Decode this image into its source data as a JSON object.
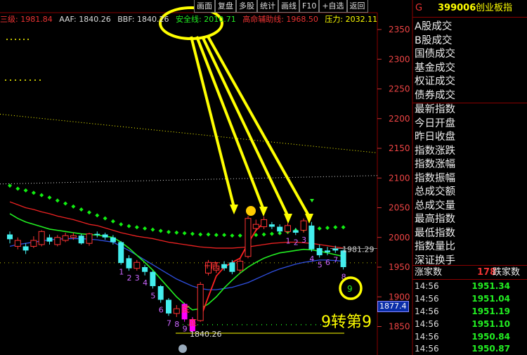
{
  "toolbar": {
    "items": [
      "画面",
      "复盘",
      "多股",
      "统计",
      "画线",
      "F10",
      "+自选",
      "返回"
    ]
  },
  "indicators": [
    {
      "label": "三级: 1981.84",
      "color": "#e33"
    },
    {
      "label": "AAF: 1840.26",
      "color": "#ddd"
    },
    {
      "label": "BBF: 1840.26",
      "color": "#ddd"
    },
    {
      "label": "安全线: 2010.71",
      "color": "#2e2"
    },
    {
      "label": "高命辅助线: 1968.50",
      "color": "#e33"
    },
    {
      "label": "压力: 2032.11",
      "color": "#ff0"
    }
  ],
  "header": {
    "market_code": "G",
    "code": "399006",
    "name": "创业板指"
  },
  "menu_group1": [
    "A股成交",
    "B股成交",
    "国债成交",
    "基金成交",
    "权证成交",
    "债券成交"
  ],
  "menu_group2": [
    "最新指数",
    "今日开盘",
    "昨日收盘",
    "指数涨跌",
    "指数涨幅",
    "指数振幅",
    "总成交额",
    "总成交量",
    "最高指数",
    "最低指数",
    "指数量比",
    "深证换手"
  ],
  "stats": {
    "up_label": "涨家数",
    "up_count": "178",
    "down_label": "跌家数"
  },
  "ticks": [
    {
      "time": "14:56",
      "value": "1951.34"
    },
    {
      "time": "14:56",
      "value": "1951.04"
    },
    {
      "time": "14:56",
      "value": "1951.19"
    },
    {
      "time": "14:56",
      "value": "1951.10"
    },
    {
      "time": "14:56",
      "value": "1950.84"
    },
    {
      "time": "14:56",
      "value": "1950.87"
    }
  ],
  "annotation": {
    "label": "9转第9",
    "circle_digit": "9"
  },
  "price_tag": "1877.4",
  "chart_data": {
    "type": "candlestick",
    "y_ticks": [
      2350,
      2300,
      2250,
      2200,
      2150,
      2100,
      2050,
      2000,
      1950,
      1900,
      1850
    ],
    "ylim": [
      1830,
      2365
    ],
    "last_price_label": "1981.29",
    "low_label": "1840.26",
    "candles": [
      {
        "o": 2005,
        "c": 1997,
        "h": 2010,
        "l": 1990
      },
      {
        "o": 1985,
        "c": 1995,
        "h": 2000,
        "l": 1980
      },
      {
        "o": 1985,
        "c": 1978,
        "h": 1990,
        "l": 1972
      },
      {
        "o": 1985,
        "c": 1995,
        "h": 2002,
        "l": 1982
      },
      {
        "o": 1988,
        "c": 2010,
        "h": 2012,
        "l": 1985
      },
      {
        "o": 2000,
        "c": 1993,
        "h": 2005,
        "l": 1988
      },
      {
        "o": 1988,
        "c": 2000,
        "h": 2004,
        "l": 1985
      },
      {
        "o": 1995,
        "c": 2003,
        "h": 2008,
        "l": 1992
      },
      {
        "o": 2000,
        "c": 2003,
        "h": 2008,
        "l": 1996
      },
      {
        "o": 2003,
        "c": 1990,
        "h": 2006,
        "l": 1988
      },
      {
        "o": 1990,
        "c": 2006,
        "h": 2008,
        "l": 1986
      },
      {
        "o": 2006,
        "c": 2004,
        "h": 2010,
        "l": 2000
      },
      {
        "o": 2005,
        "c": 2000,
        "h": 2008,
        "l": 1996
      },
      {
        "o": 2000,
        "c": 1992,
        "h": 2004,
        "l": 1988
      },
      {
        "o": 1992,
        "c": 1957,
        "h": 1994,
        "l": 1954
      },
      {
        "o": 1965,
        "c": 1948,
        "h": 1970,
        "l": 1944
      },
      {
        "o": 1948,
        "c": 1958,
        "h": 1962,
        "l": 1944
      },
      {
        "o": 1950,
        "c": 1942,
        "h": 1954,
        "l": 1936
      },
      {
        "o": 1942,
        "c": 1918,
        "h": 1944,
        "l": 1914
      },
      {
        "o": 1918,
        "c": 1895,
        "h": 1920,
        "l": 1890
      },
      {
        "o": 1895,
        "c": 1872,
        "h": 1898,
        "l": 1868
      },
      {
        "o": 1872,
        "c": 1880,
        "h": 1886,
        "l": 1866
      },
      {
        "o": 1888,
        "c": 1862,
        "h": 1890,
        "l": 1858
      },
      {
        "o": 1862,
        "c": 1842,
        "h": 1866,
        "l": 1838
      },
      {
        "o": 1860,
        "c": 1921,
        "h": 1925,
        "l": 1858
      },
      {
        "o": 1940,
        "c": 1958,
        "h": 1962,
        "l": 1936
      },
      {
        "o": 1945,
        "c": 1952,
        "h": 1958,
        "l": 1940
      },
      {
        "o": 1955,
        "c": 1948,
        "h": 1960,
        "l": 1944
      },
      {
        "o": 1958,
        "c": 1942,
        "h": 1962,
        "l": 1938
      },
      {
        "o": 1945,
        "c": 1960,
        "h": 1964,
        "l": 1940
      },
      {
        "o": 1968,
        "c": 2032,
        "h": 2036,
        "l": 1965
      },
      {
        "o": 2015,
        "c": 2022,
        "h": 2030,
        "l": 2010
      },
      {
        "o": 2018,
        "c": 2030,
        "h": 2035,
        "l": 2014
      },
      {
        "o": 2022,
        "c": 2018,
        "h": 2026,
        "l": 2014
      },
      {
        "o": 2018,
        "c": 2010,
        "h": 2022,
        "l": 2006
      },
      {
        "o": 2010,
        "c": 2020,
        "h": 2024,
        "l": 2006
      },
      {
        "o": 2012,
        "c": 2008,
        "h": 2016,
        "l": 2004
      },
      {
        "o": 2012,
        "c": 2028,
        "h": 2032,
        "l": 2008
      },
      {
        "o": 2020,
        "c": 1980,
        "h": 2026,
        "l": 1976
      },
      {
        "o": 1982,
        "c": 1970,
        "h": 1988,
        "l": 1966
      },
      {
        "o": 1978,
        "c": 1975,
        "h": 1984,
        "l": 1970
      },
      {
        "o": 1982,
        "c": 1978,
        "h": 1986,
        "l": 1974
      },
      {
        "o": 1978,
        "c": 1950,
        "h": 1980,
        "l": 1946
      }
    ],
    "safety_line": [
      2080,
      2075,
      2072,
      2068,
      2064,
      2060,
      2055,
      2050,
      2045,
      2040,
      2035,
      2030,
      2025,
      2020,
      2015,
      2012,
      2010,
      2008,
      2006,
      2004,
      2002,
      2001,
      2000,
      1999,
      1998,
      1998,
      1997,
      1997,
      1996,
      1996,
      1996,
      1997,
      1998,
      1999,
      2000,
      2002,
      2005,
      2006,
      2007,
      2008,
      2009,
      2010,
      2010
    ],
    "red_ma": [
      2060,
      2055,
      2050,
      2047,
      2043,
      2040,
      2036,
      2033,
      2030,
      2026,
      2022,
      2020,
      2016,
      2012,
      2008,
      2005,
      2002,
      2000,
      1998,
      1995,
      1992,
      1990,
      1988,
      1986,
      1984,
      1983,
      1982,
      1982,
      1982,
      1983,
      1984,
      1986,
      1988,
      1990,
      1991,
      1992,
      1992,
      1991,
      1990,
      1988,
      1986,
      1984,
      1982
    ],
    "green_ma": [
      2040,
      2032,
      2026,
      2022,
      2018,
      2014,
      2012,
      2010,
      2008,
      2006,
      2005,
      2004,
      2002,
      2000,
      1992,
      1982,
      1970,
      1958,
      1945,
      1930,
      1915,
      1900,
      1888,
      1878,
      1880,
      1888,
      1900,
      1915,
      1928,
      1940,
      1950,
      1958,
      1965,
      1970,
      1974,
      1976,
      1978,
      1980,
      1979,
      1977,
      1974,
      1971,
      1968
    ],
    "blue_ma": [
      1985,
      1988,
      1990,
      1992,
      1994,
      1996,
      1997,
      1998,
      1998,
      1998,
      1997,
      1996,
      1994,
      1992,
      1985,
      1978,
      1970,
      1962,
      1954,
      1946,
      1938,
      1930,
      1924,
      1918,
      1914,
      1912,
      1912,
      1914,
      1916,
      1920,
      1924,
      1930,
      1936,
      1942,
      1947,
      1951,
      1955,
      1958,
      1960,
      1962,
      1962,
      1961,
      1960
    ],
    "trend_line": [
      null,
      null,
      null,
      null,
      null,
      null,
      null,
      null,
      null,
      null,
      null,
      null,
      null,
      null,
      null,
      null,
      null,
      null,
      null,
      null,
      null,
      null,
      null,
      null,
      1864,
      1900,
      1935,
      1950,
      1958,
      1965,
      1990,
      2012,
      2025,
      null,
      null,
      null,
      null,
      null,
      null,
      null,
      null,
      null,
      null
    ],
    "white_dotted_y": 2090,
    "green_dotted_y": 1865,
    "yellow_dotted_y": 2172,
    "count_labels": [
      {
        "i": 14,
        "t": "1",
        "above": false
      },
      {
        "i": 15,
        "t": "2",
        "above": false
      },
      {
        "i": 16,
        "t": "3",
        "above": false
      },
      {
        "i": 17,
        "t": "4",
        "above": false
      },
      {
        "i": 18,
        "t": "5",
        "above": false
      },
      {
        "i": 19,
        "t": "6",
        "above": false
      },
      {
        "i": 20,
        "t": "7",
        "above": false
      },
      {
        "i": 21,
        "t": "8",
        "above": false
      },
      {
        "i": 22,
        "t": "9",
        "above": false
      },
      {
        "i": 35,
        "t": "1",
        "above": false
      },
      {
        "i": 36,
        "t": "2",
        "above": false
      },
      {
        "i": 37,
        "t": "3",
        "above": false
      },
      {
        "i": 38,
        "t": "4",
        "above": false
      },
      {
        "i": 39,
        "t": "5",
        "above": false
      },
      {
        "i": 40,
        "t": "6",
        "above": false
      },
      {
        "i": 41,
        "t": "7",
        "above": false
      },
      {
        "i": 42,
        "t": "8",
        "above": false
      }
    ],
    "bottom_labels": [
      "底",
      "底",
      "+底"
    ]
  }
}
